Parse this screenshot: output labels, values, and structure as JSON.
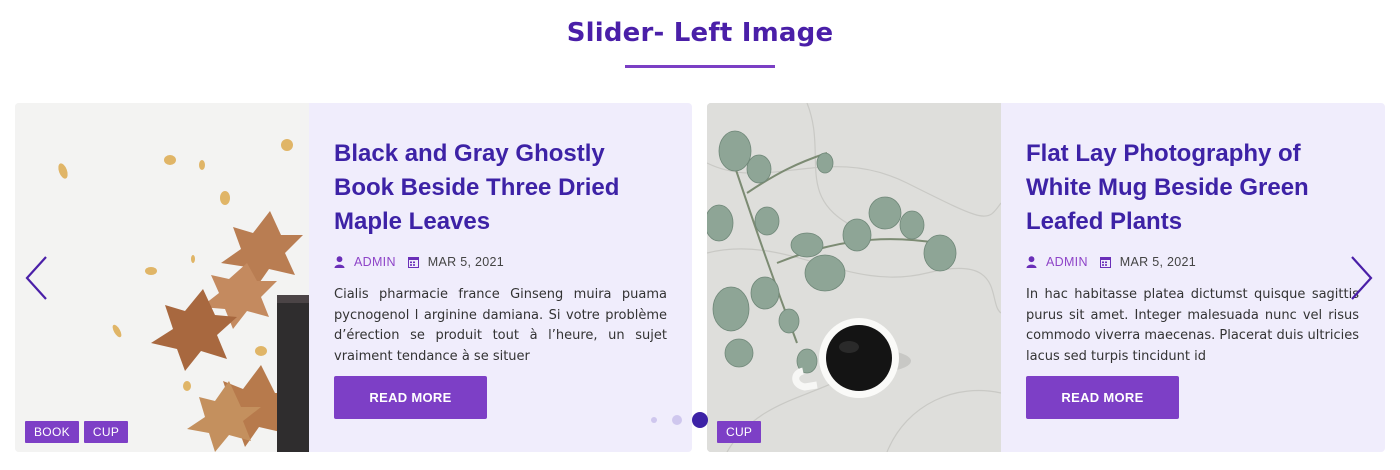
{
  "section": {
    "title": "Slider- Left Image"
  },
  "colors": {
    "title": "#4a1fa8",
    "accent": "#7d3fc6",
    "card_background": "#f0edfc",
    "post_title": "#3d22a6"
  },
  "slides": [
    {
      "title": "Black and Gray Ghostly Book Beside Three Dried Maple Leaves",
      "author": "ADMIN",
      "date": "MAR 5, 2021",
      "excerpt": "Cialis pharmacie france Ginseng muira puama pycnogenol l arginine damiana. Si votre problème d’érection se produit tout à l’heure, un sujet vraiment tendance à se situer",
      "button_label": "READ MORE",
      "tags": [
        "BOOK",
        "CUP"
      ]
    },
    {
      "title": "Flat Lay Photography of White Mug Beside Green Leafed Plants",
      "author": "ADMIN",
      "date": "MAR 5, 2021",
      "excerpt": "In hac habitasse platea dictumst quisque sagittis purus sit amet. Integer malesuada nunc vel risus commodo viverra maecenas. Placerat duis ultricies lacus sed turpis tincidunt id",
      "button_label": "READ MORE",
      "tags": [
        "CUP"
      ]
    }
  ],
  "navigation": {
    "prev_icon": "chevron-left-icon",
    "next_icon": "chevron-right-icon",
    "pagination_count": 3,
    "active_index": 3
  },
  "icons": {
    "author": "user-icon",
    "date": "calendar-icon"
  }
}
